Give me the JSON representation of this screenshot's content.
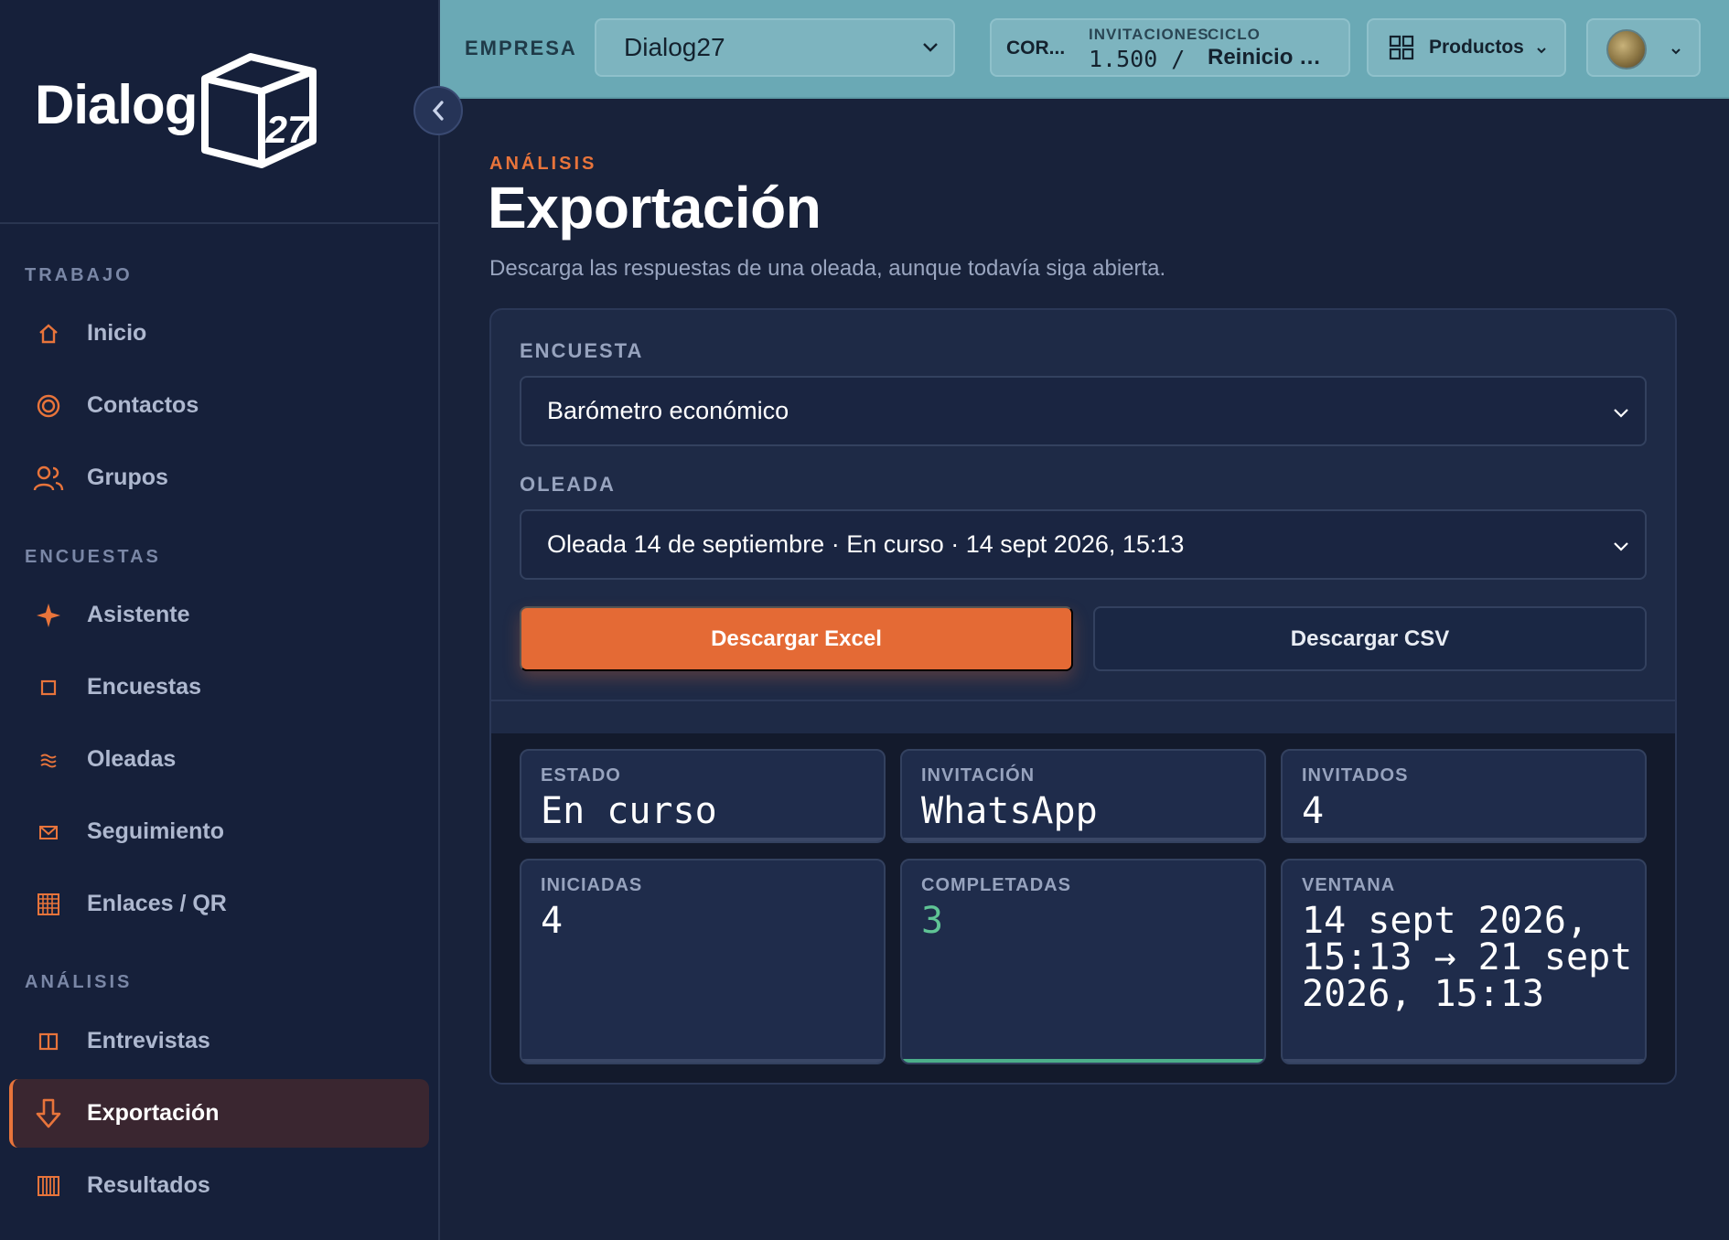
{
  "sidebar": {
    "logo_text": "Dialog",
    "logo_cube_text": "27",
    "collapse_icon": "chevron-left-icon",
    "sections": [
      {
        "label": "TRABAJO"
      },
      {
        "label": "ENCUESTAS"
      },
      {
        "label": "ANÁLISIS"
      }
    ],
    "items": [
      {
        "label": "Inicio",
        "icon": "home-icon"
      },
      {
        "label": "Contactos",
        "icon": "target-icon"
      },
      {
        "label": "Grupos",
        "icon": "users-icon"
      },
      {
        "label": "Asistente",
        "icon": "sparkle-icon"
      },
      {
        "label": "Encuestas",
        "icon": "square-icon"
      },
      {
        "label": "Oleadas",
        "icon": "waves-icon"
      },
      {
        "label": "Seguimiento",
        "icon": "envelope-icon"
      },
      {
        "label": "Enlaces / QR",
        "icon": "qr-icon"
      },
      {
        "label": "Entrevistas",
        "icon": "columns-icon"
      },
      {
        "label": "Exportación",
        "icon": "download-arrow-icon",
        "active": true
      },
      {
        "label": "Resultados",
        "icon": "bars-icon"
      }
    ]
  },
  "topbar": {
    "company_label": "EMPRESA",
    "company_value": "Dialog27",
    "stats": {
      "cor": "COR...",
      "invitations_label": "INVITACIONES",
      "invitations_value": "1.500 /",
      "cycle_label": "CICLO",
      "cycle_value": "Reinicio mensual"
    },
    "products_label": "Productos"
  },
  "main": {
    "eyebrow": "ANÁLISIS",
    "title": "Exportación",
    "description": "Descarga las respuestas de una oleada, aunque todavía siga abierta.",
    "survey_label": "ENCUESTA",
    "survey_value": "Barómetro económico",
    "wave_label": "OLEADA",
    "wave_value": "Oleada 14 de septiembre · En curso · 14 sept 2026, 15:13",
    "download_excel": "Descargar Excel",
    "download_csv": "Descargar CSV",
    "stats": [
      {
        "label": "ESTADO",
        "value": "En curso"
      },
      {
        "label": "INVITACIÓN",
        "value": "WhatsApp"
      },
      {
        "label": "INVITADOS",
        "value": "4"
      },
      {
        "label": "INICIADAS",
        "value": "4"
      },
      {
        "label": "COMPLETADAS",
        "value": "3"
      },
      {
        "label": "VENTANA",
        "value": "14 sept 2026, 15:13 → 21 sept 2026, 15:13"
      }
    ]
  },
  "colors": {
    "accent": "#e8743b",
    "topbar": "#6aa9b5",
    "success": "#5fc495",
    "background": "#18223a"
  }
}
